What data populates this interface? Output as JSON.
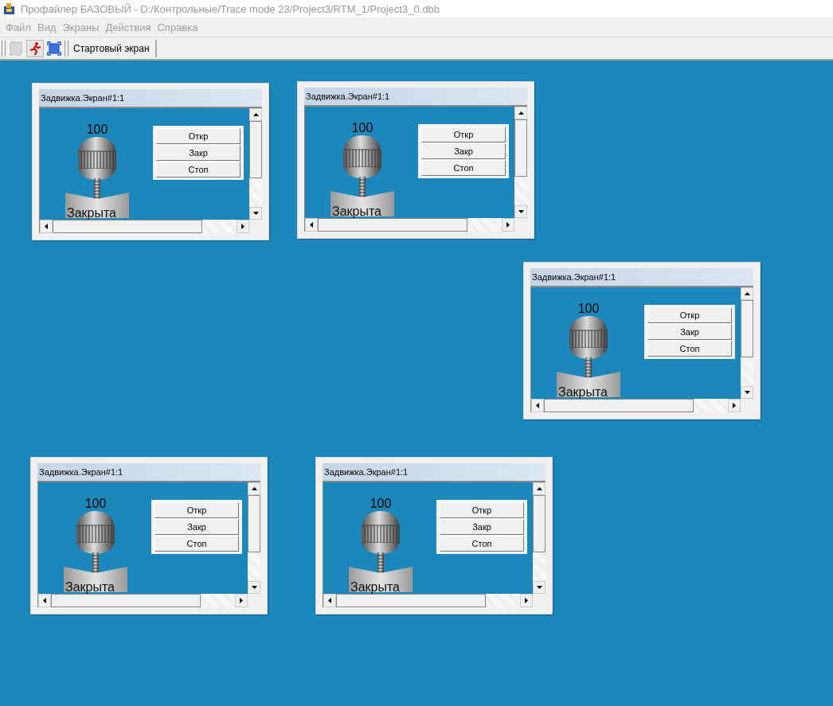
{
  "window": {
    "title": "Профайлер БАЗОВЫЙ - D:/Контрольные/Trace mode 23/Project3/RTM_1/Project3_0.dbb"
  },
  "menu": [
    {
      "label": "Файл",
      "disabled": true
    },
    {
      "label": "Вид",
      "disabled": true
    },
    {
      "label": "Экраны",
      "disabled": true
    },
    {
      "label": "Действия",
      "disabled": true
    },
    {
      "label": "Справка",
      "disabled": true
    }
  ],
  "toolbar": {
    "icons": [
      {
        "kind": "map",
        "disabled": true,
        "selected": false
      },
      {
        "kind": "run",
        "disabled": false,
        "selected": true
      },
      {
        "kind": "frame",
        "disabled": false,
        "selected": false
      }
    ],
    "start_screen_button": "Стартовый экран"
  },
  "child_windows": [
    {
      "title": "Задвижка.Экран#1:1",
      "value": "100",
      "state": "Закрыта",
      "buttons": [
        "Откр",
        "Закр",
        "Стоп"
      ]
    },
    {
      "title": "Задвижка.Экран#1:1",
      "value": "100",
      "state": "Закрыта",
      "buttons": [
        "Откр",
        "Закр",
        "Стоп"
      ]
    },
    {
      "title": "Задвижка.Экран#1:1",
      "value": "100",
      "state": "Закрыта",
      "buttons": [
        "Откр",
        "Закр",
        "Стоп"
      ]
    },
    {
      "title": "Задвижка.Экран#1:1",
      "value": "100",
      "state": "Закрыта",
      "buttons": [
        "Откр",
        "Закр",
        "Стоп"
      ]
    },
    {
      "title": "Задвижка.Экран#1:1",
      "value": "100",
      "state": "Закрыта",
      "buttons": [
        "Откр",
        "Закр",
        "Стоп"
      ]
    }
  ]
}
